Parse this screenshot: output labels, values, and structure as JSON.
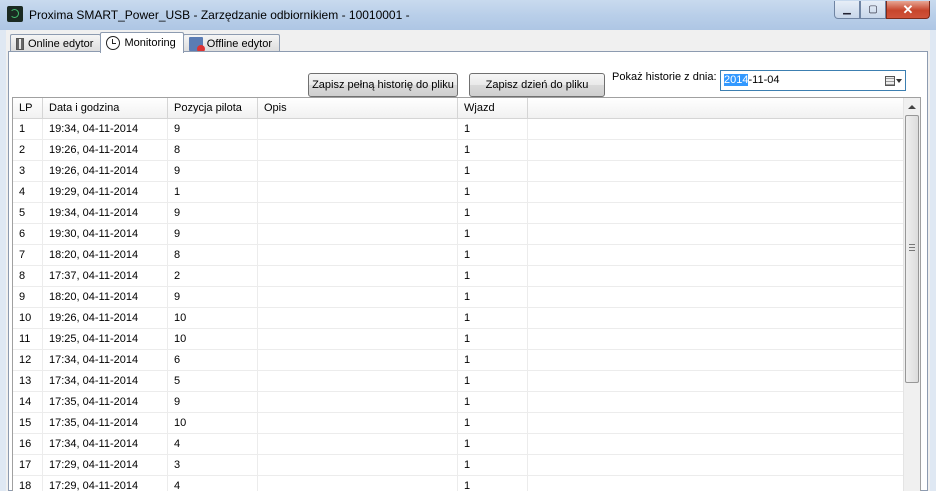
{
  "window": {
    "title": "Proxima SMART_Power_USB - Zarzędzanie odbiornikiem - 10010001 -",
    "min_glyph": "▁",
    "max_glyph": "▢",
    "close_glyph": "✕"
  },
  "tabs": [
    {
      "label": "Online edytor",
      "icon": "chip-icon"
    },
    {
      "label": "Monitoring",
      "icon": "clock-icon",
      "active": true
    },
    {
      "label": "Offline edytor",
      "icon": "offline-icon"
    }
  ],
  "toolbar": {
    "save_full_label": "Zapisz pełną historię do pliku",
    "save_day_label": "Zapisz dzień do pliku",
    "show_history_label": "Pokaż historie z dnia:",
    "date_selected_part": "2014",
    "date_rest": "-11-04"
  },
  "table": {
    "columns": [
      "LP",
      "Data i godzina",
      "Pozycja pilota",
      "Opis",
      "Wjazd",
      ""
    ],
    "rows": [
      [
        "1",
        "19:34, 04-11-2014",
        "9",
        "",
        "1"
      ],
      [
        "2",
        "19:26, 04-11-2014",
        "8",
        "",
        "1"
      ],
      [
        "3",
        "19:26, 04-11-2014",
        "9",
        "",
        "1"
      ],
      [
        "4",
        "19:29, 04-11-2014",
        "1",
        "",
        "1"
      ],
      [
        "5",
        "19:34, 04-11-2014",
        "9",
        "",
        "1"
      ],
      [
        "6",
        "19:30, 04-11-2014",
        "9",
        "",
        "1"
      ],
      [
        "7",
        "18:20, 04-11-2014",
        "8",
        "",
        "1"
      ],
      [
        "8",
        "17:37, 04-11-2014",
        "2",
        "",
        "1"
      ],
      [
        "9",
        "18:20, 04-11-2014",
        "9",
        "",
        "1"
      ],
      [
        "10",
        "19:26, 04-11-2014",
        "10",
        "",
        "1"
      ],
      [
        "11",
        "19:25, 04-11-2014",
        "10",
        "",
        "1"
      ],
      [
        "12",
        "17:34, 04-11-2014",
        "6",
        "",
        "1"
      ],
      [
        "13",
        "17:34, 04-11-2014",
        "5",
        "",
        "1"
      ],
      [
        "14",
        "17:35, 04-11-2014",
        "9",
        "",
        "1"
      ],
      [
        "15",
        "17:35, 04-11-2014",
        "10",
        "",
        "1"
      ],
      [
        "16",
        "17:34, 04-11-2014",
        "4",
        "",
        "1"
      ],
      [
        "17",
        "17:29, 04-11-2014",
        "3",
        "",
        "1"
      ],
      [
        "18",
        "17:29, 04-11-2014",
        "4",
        "",
        "1"
      ]
    ]
  }
}
